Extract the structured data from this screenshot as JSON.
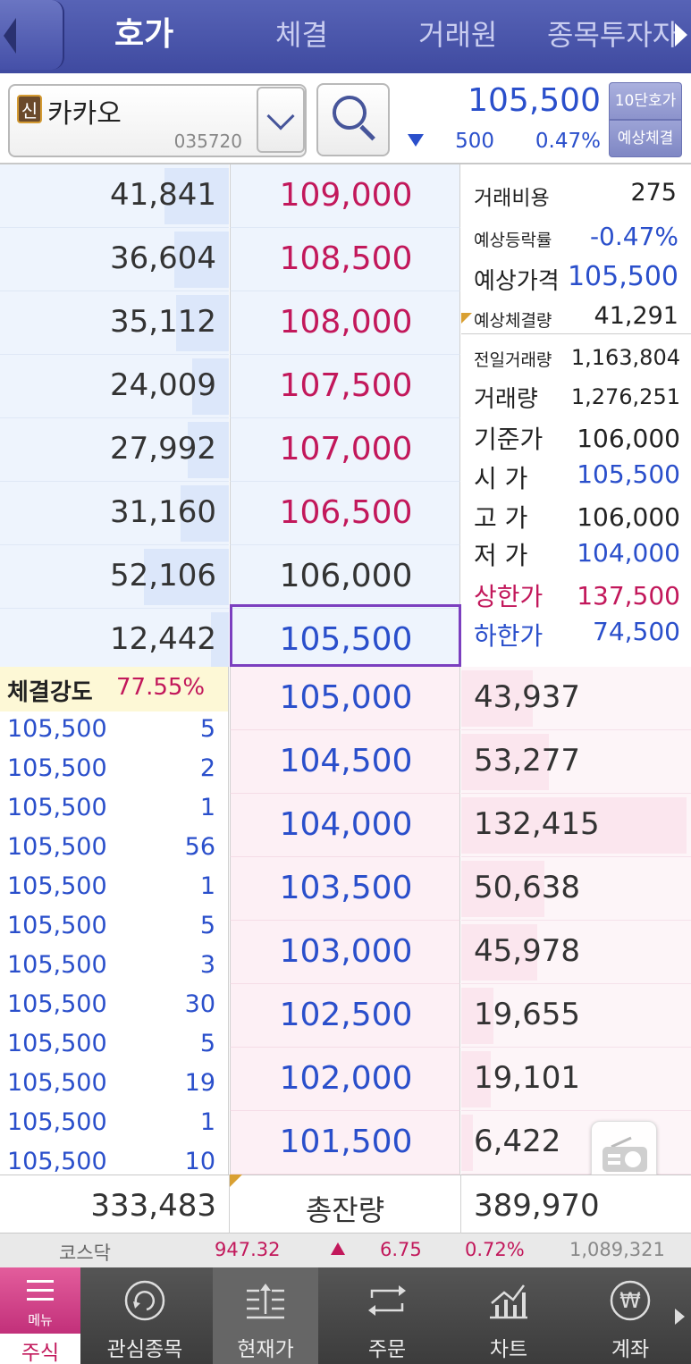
{
  "header": {
    "tabs": [
      {
        "label": "호가",
        "active": true
      },
      {
        "label": "체결",
        "active": false
      },
      {
        "label": "거래원",
        "active": false
      },
      {
        "label": "종목투자자",
        "active": false
      }
    ]
  },
  "stock": {
    "badge": "신",
    "name": "카카오",
    "code": "035720",
    "current_price": "105,500",
    "change": "500",
    "change_rate": "0.47%",
    "direction": "down",
    "btn_10": "10단호가",
    "btn_expected": "예상체결"
  },
  "asks": [
    {
      "volume": "41,841",
      "price": "109,000",
      "color": "#c2185b",
      "bar": 0.28
    },
    {
      "volume": "36,604",
      "price": "108,500",
      "color": "#c2185b",
      "bar": 0.24
    },
    {
      "volume": "35,112",
      "price": "108,000",
      "color": "#c2185b",
      "bar": 0.23
    },
    {
      "volume": "24,009",
      "price": "107,500",
      "color": "#c2185b",
      "bar": 0.16
    },
    {
      "volume": "27,992",
      "price": "107,000",
      "color": "#c2185b",
      "bar": 0.18
    },
    {
      "volume": "31,160",
      "price": "106,500",
      "color": "#c2185b",
      "bar": 0.21
    },
    {
      "volume": "52,106",
      "price": "106,000",
      "color": "#333333",
      "bar": 0.37
    },
    {
      "volume": "12,442",
      "price": "105,500",
      "color": "#2a4fcb",
      "bar": 0.08
    }
  ],
  "bids": [
    {
      "price": "105,000",
      "volume": "43,937",
      "bar": 0.31
    },
    {
      "price": "104,500",
      "volume": "53,277",
      "bar": 0.38
    },
    {
      "price": "104,000",
      "volume": "132,415",
      "bar": 0.98
    },
    {
      "price": "103,500",
      "volume": "50,638",
      "bar": 0.36
    },
    {
      "price": "103,000",
      "volume": "45,978",
      "bar": 0.33
    },
    {
      "price": "102,500",
      "volume": "19,655",
      "bar": 0.14
    },
    {
      "price": "102,000",
      "volume": "19,101",
      "bar": 0.13
    },
    {
      "price": "101,500",
      "volume": "6,422",
      "bar": 0.05
    }
  ],
  "info_top": {
    "fee_label": "거래비용",
    "fee": "275",
    "exp_rate_label": "예상등락률",
    "exp_rate": "-0.47%",
    "exp_price_label": "예상가격",
    "exp_price": "105,500",
    "exp_volume_label": "예상체결량",
    "exp_volume": "41,291"
  },
  "info_bottom": {
    "prev_volume_label": "전일거래량",
    "prev_volume": "1,163,804",
    "volume_label": "거래량",
    "volume": "1,276,251",
    "base_label": "기준가",
    "base": "106,000",
    "open_label": "시 가",
    "open": "105,500",
    "high_label": "고 가",
    "high": "106,000",
    "low_label": "저 가",
    "low": "104,000",
    "upper_label": "상한가",
    "upper": "137,500",
    "lower_label": "하한가",
    "lower": "74,500"
  },
  "trades": {
    "strength_label": "체결강도",
    "strength": "77.55%",
    "rows": [
      {
        "price": "105,500",
        "qty": "5"
      },
      {
        "price": "105,500",
        "qty": "2"
      },
      {
        "price": "105,500",
        "qty": "1"
      },
      {
        "price": "105,500",
        "qty": "56"
      },
      {
        "price": "105,500",
        "qty": "1"
      },
      {
        "price": "105,500",
        "qty": "5"
      },
      {
        "price": "105,500",
        "qty": "3"
      },
      {
        "price": "105,500",
        "qty": "30"
      },
      {
        "price": "105,500",
        "qty": "5"
      },
      {
        "price": "105,500",
        "qty": "19"
      },
      {
        "price": "105,500",
        "qty": "1"
      },
      {
        "price": "105,500",
        "qty": "10"
      }
    ]
  },
  "totals": {
    "ask_total": "333,483",
    "label": "총잔량",
    "bid_total": "389,970"
  },
  "market": {
    "name": "코스닥",
    "index": "947.32",
    "change": "6.75",
    "rate": "0.72%",
    "volume": "1,089,321"
  },
  "bottom_nav": {
    "menu_label": "메뉴",
    "stock_label": "주식",
    "items": [
      {
        "label": "관심종목",
        "icon": "refresh-circle-icon",
        "active": false
      },
      {
        "label": "현재가",
        "icon": "current-price-icon",
        "active": true
      },
      {
        "label": "주문",
        "icon": "order-exchange-icon",
        "active": false
      },
      {
        "label": "차트",
        "icon": "chart-icon",
        "active": false
      },
      {
        "label": "계좌",
        "icon": "won-icon",
        "active": false
      }
    ]
  }
}
